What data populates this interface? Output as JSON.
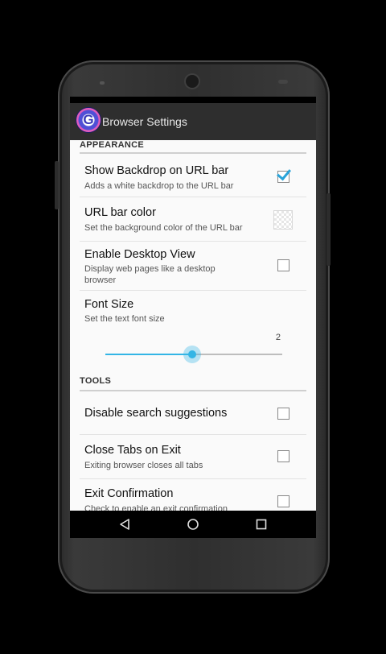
{
  "app": {
    "title": "Browser Settings",
    "icon_letter": "G"
  },
  "sections": {
    "appearance": {
      "header": "APPEARANCE",
      "items": [
        {
          "title": "Show Backdrop on URL bar",
          "summary": "Adds a white backdrop to the URL bar",
          "checked": true
        },
        {
          "title": "URL bar color",
          "summary": "Set the background color of the URL bar"
        },
        {
          "title": "Enable Desktop View",
          "summary": "Display web pages like a desktop browser",
          "checked": false
        },
        {
          "title": "Font Size",
          "summary": "Set the text font size",
          "value": "2",
          "slider_fraction": 0.49
        }
      ]
    },
    "tools": {
      "header": "TOOLS",
      "items": [
        {
          "title": "Disable search suggestions",
          "checked": false
        },
        {
          "title": "Close Tabs on Exit",
          "summary": "Exiting browser closes all tabs",
          "checked": false
        },
        {
          "title": "Exit Confirmation",
          "summary": "Check to enable an exit confirmation",
          "checked": false
        }
      ]
    }
  },
  "navbar": {
    "icons": [
      "back-icon",
      "home-icon",
      "recents-icon"
    ]
  },
  "colors": {
    "accent": "#33b5e5",
    "action_bar": "#2e2e2e",
    "background": "#fafafa"
  }
}
